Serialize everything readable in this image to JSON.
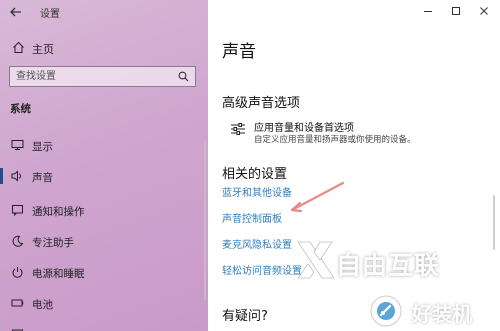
{
  "window": {
    "app_title": "设置",
    "controls": [
      "minimize",
      "maximize",
      "close"
    ]
  },
  "sidebar": {
    "home_label": "主页",
    "search_placeholder": "查找设置",
    "section_title": "系统",
    "items": [
      {
        "label": "显示",
        "icon": "monitor-icon",
        "active": false
      },
      {
        "label": "声音",
        "icon": "speaker-icon",
        "active": true
      },
      {
        "label": "通知和操作",
        "icon": "notification-icon",
        "active": false
      },
      {
        "label": "专注助手",
        "icon": "moon-icon",
        "active": false
      },
      {
        "label": "电源和睡眠",
        "icon": "power-icon",
        "active": false
      },
      {
        "label": "电池",
        "icon": "battery-icon",
        "active": false
      }
    ]
  },
  "main": {
    "title": "声音",
    "advanced_heading": "高级声音选项",
    "advanced_item": {
      "title": "应用音量和设备首选项",
      "desc": "自定义应用音量和扬声器或你使用的设备。"
    },
    "related_heading": "相关的设置",
    "related_links": [
      "蓝牙和其他设备",
      "声音控制面板",
      "麦克风隐私设置",
      "轻松访问音频设置"
    ],
    "question_heading": "有疑问?"
  },
  "watermarks": {
    "ziyou": "自由互联",
    "haozhuangji": "好装机"
  },
  "colors": {
    "link": "#2f7fc1",
    "active_indicator": "#1f4e8c",
    "annotation_arrow": "#e88a8a"
  }
}
